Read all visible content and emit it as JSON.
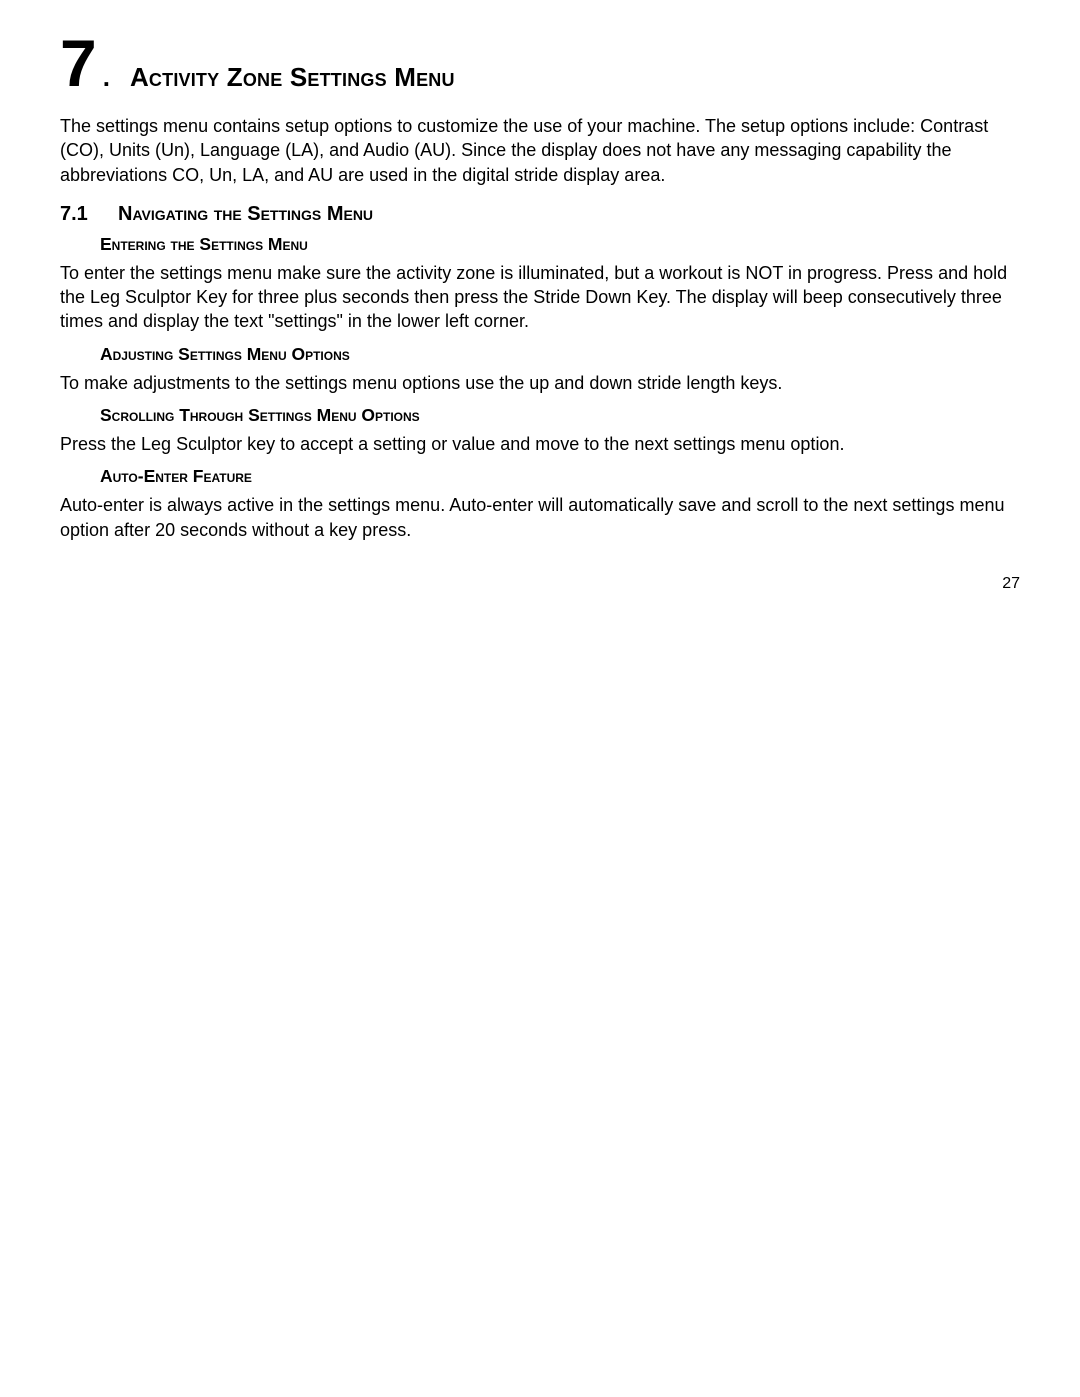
{
  "chapter": {
    "number": "7",
    "dot": ".",
    "title": "Activity Zone Settings Menu"
  },
  "intro": "The settings menu contains setup options to customize the use of your machine. The setup options include: Contrast (CO), Units (Un), Language (LA), and Audio (AU).  Since the display does not have any messaging capability the abbreviations CO, Un, LA, and AU are used in the digital stride display area.",
  "section": {
    "number": "7.1",
    "title": "Navigating the Settings Menu"
  },
  "sub1": {
    "title": "Entering the Settings Menu",
    "text": "To enter the settings menu make sure the activity zone is illuminated, but a workout is NOT in progress. Press and hold the Leg Sculptor Key for three plus seconds then press the Stride Down Key. The display will beep consecutively three times and display the text \"settings\" in the lower left corner."
  },
  "sub2": {
    "title": "Adjusting Settings Menu Options",
    "text": "To make adjustments to the settings menu options use the up and down stride length keys."
  },
  "sub3": {
    "title": "Scrolling Through Settings Menu Options",
    "text": "Press the Leg Sculptor key to accept a setting or value and move to the next settings menu option."
  },
  "sub4": {
    "title": "Auto-Enter Feature",
    "text": "Auto-enter is always active in the settings menu. Auto-enter will automatically save and scroll to the next settings menu option after 20 seconds without a key press."
  },
  "page_number": "27"
}
